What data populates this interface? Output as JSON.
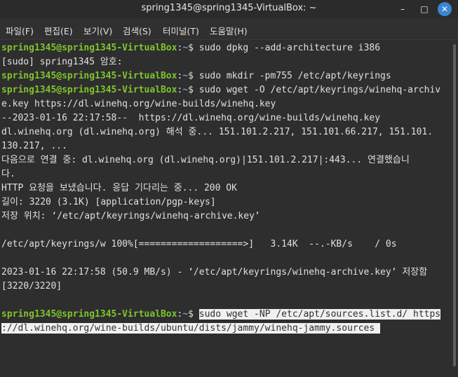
{
  "window": {
    "title": "spring1345@spring1345-VirtualBox: ~",
    "minimize_glyph": "–",
    "maximize_glyph": "□",
    "close_glyph": "✕"
  },
  "menu": {
    "file": "파일(F)",
    "edit": "편집(E)",
    "view": "보기(V)",
    "search": "검색(S)",
    "terminal": "터미널(T)",
    "help": "도움말(H)"
  },
  "prompt": {
    "user_host": "spring1345@spring1345-VirtualBox",
    "colon": ":",
    "cwd": "~",
    "dollar": "$ "
  },
  "lines": {
    "cmd1": "sudo dpkg --add-architecture i386",
    "l2": "[sudo] spring1345 암호:",
    "cmd3": "sudo mkdir -pm755 /etc/apt/keyrings",
    "cmd4": "sudo wget -O /etc/apt/keyrings/winehq-archiv",
    "l5": "e.key https://dl.winehq.org/wine-builds/winehq.key",
    "l6": "--2023-01-16 22:17:58--  https://dl.winehq.org/wine-builds/winehq.key",
    "l7": "dl.winehq.org (dl.winehq.org) 해석 중... 151.101.2.217, 151.101.66.217, 151.101.",
    "l8": "130.217, ...",
    "l9": "다음으로 연결 중: dl.winehq.org (dl.winehq.org)|151.101.2.217|:443... 연결했습니",
    "l10": "다.",
    "l11": "HTTP 요청을 보냈습니다. 응답 기다리는 중... 200 OK",
    "l12": "길이: 3220 (3.1K) [application/pgp-keys]",
    "l13": "저장 위치: ‘/etc/apt/keyrings/winehq-archive.key’",
    "l14": "",
    "l15": "/etc/apt/keyrings/w 100%[===================>]   3.14K  --.-KB/s    / 0s",
    "l16": "",
    "l17": "2023-01-16 22:17:58 (50.9 MB/s) - ‘/etc/apt/keyrings/winehq-archive.key’ 저장함",
    "l18": "[3220/3220]",
    "l19": "",
    "cmd20": "sudo wget -NP /etc/apt/sources.list.d/ https",
    "l21": "://dl.winehq.org/wine-builds/ubuntu/dists/jammy/winehq-jammy.sources "
  },
  "colors": {
    "prompt_user": "#7fc52c",
    "prompt_cwd": "#5aa0e6",
    "background": "#2e2e2e",
    "selection": "#f0f0f0",
    "close_button": "#3b85d4"
  }
}
